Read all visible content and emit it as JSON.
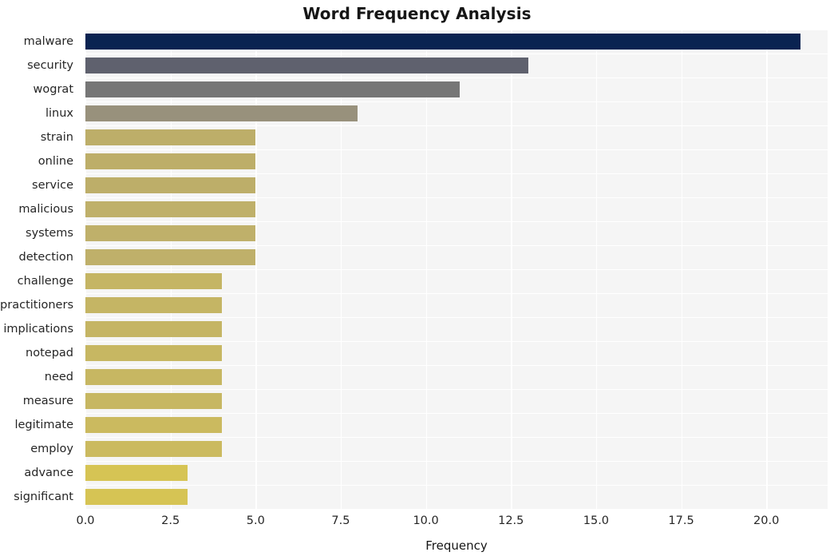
{
  "chart_data": {
    "type": "bar",
    "orientation": "horizontal",
    "title": "Word Frequency Analysis",
    "xlabel": "Frequency",
    "ylabel": "",
    "xlim": [
      0,
      21.8
    ],
    "ylim": [
      0,
      20
    ],
    "grid": true,
    "legend": null,
    "xticks": [
      "0.0",
      "2.5",
      "5.0",
      "7.5",
      "10.0",
      "12.5",
      "15.0",
      "17.5",
      "20.0"
    ],
    "xtick_values": [
      0,
      2.5,
      5,
      7.5,
      10,
      12.5,
      15,
      17.5,
      20
    ],
    "categories": [
      "malware",
      "security",
      "wograt",
      "linux",
      "strain",
      "online",
      "service",
      "malicious",
      "systems",
      "detection",
      "challenge",
      "practitioners",
      "implications",
      "notepad",
      "need",
      "measure",
      "legitimate",
      "employ",
      "advance",
      "significant"
    ],
    "values": [
      21,
      13,
      11,
      8,
      5,
      5,
      5,
      5,
      5,
      5,
      4,
      4,
      4,
      4,
      4,
      4,
      4,
      4,
      3,
      3
    ],
    "bar_colors": [
      "#0a2351",
      "#5f616e",
      "#767676",
      "#98917c",
      "#bdae69",
      "#bdae69",
      "#bdae69",
      "#bfb06a",
      "#bfb06a",
      "#bfb06a",
      "#c5b564",
      "#c5b564",
      "#c5b564",
      "#c7b762",
      "#c7b762",
      "#c7b762",
      "#cbba5f",
      "#cbba5f",
      "#d6c454",
      "#d6c454"
    ],
    "plot_background": "#f5f5f5",
    "grid_color": "#ffffff",
    "figure_background": "#ffffff"
  }
}
